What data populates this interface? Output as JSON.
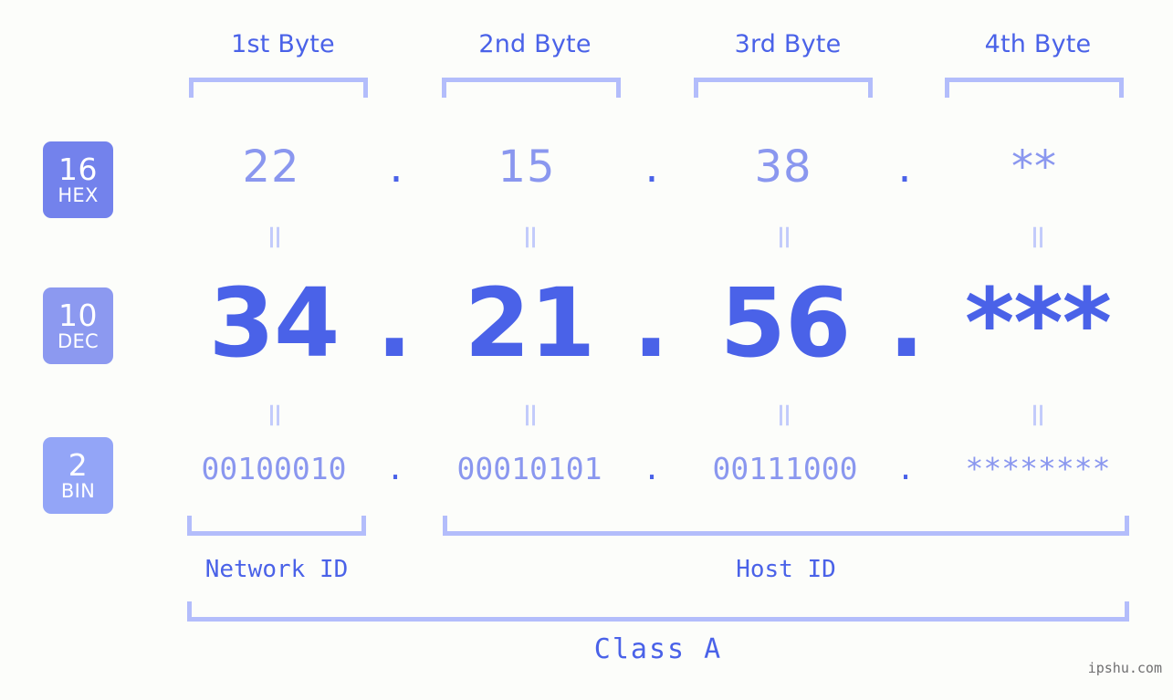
{
  "background_color": "#fcfdfa",
  "accent_color": "#4a62e8",
  "muted_accent_color": "#8a97ef",
  "bracket_color": "#b3bdfb",
  "byte_headers": [
    {
      "label": "1st Byte"
    },
    {
      "label": "2nd Byte"
    },
    {
      "label": "3rd Byte"
    },
    {
      "label": "4th Byte"
    }
  ],
  "radix_badges": [
    {
      "number": "16",
      "name": "HEX",
      "color": "#7382ec"
    },
    {
      "number": "10",
      "name": "DEC",
      "color": "#8c99f0"
    },
    {
      "number": "2",
      "name": "BIN",
      "color": "#93a5f7"
    }
  ],
  "rows": {
    "hex": {
      "values": [
        "22",
        "15",
        "38",
        "**"
      ]
    },
    "dec": {
      "values": [
        "34",
        "21",
        "56",
        "***"
      ]
    },
    "bin": {
      "values": [
        "00100010",
        "00010101",
        "00111000",
        "********"
      ]
    }
  },
  "separators": {
    "dot": ".",
    "equals": "="
  },
  "id_sections": [
    {
      "label": "Network ID"
    },
    {
      "label": "Host ID"
    }
  ],
  "class_label": "Class A",
  "watermark": "ipshu.com"
}
